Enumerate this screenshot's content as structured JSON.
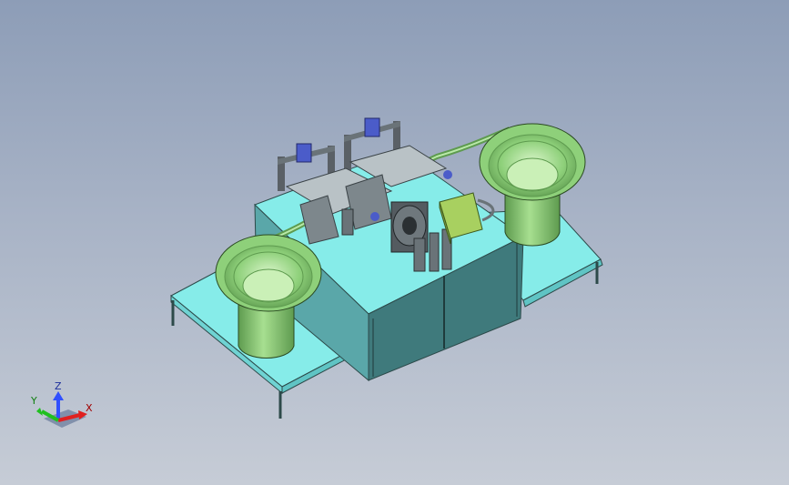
{
  "triad": {
    "x_label": "X",
    "y_label": "Y",
    "z_label": "Z",
    "x_color": "#e02020",
    "y_color": "#20c020",
    "z_color": "#3050ff"
  },
  "colors": {
    "table": "#86ece9",
    "table_side": "#5fc4c4",
    "cabinet": "#3f7a7c",
    "bowl": "#8ed07a",
    "bowl_dark": "#5e9b4f",
    "machine": "#8d9aa0",
    "motor_box": "#a8d060"
  }
}
